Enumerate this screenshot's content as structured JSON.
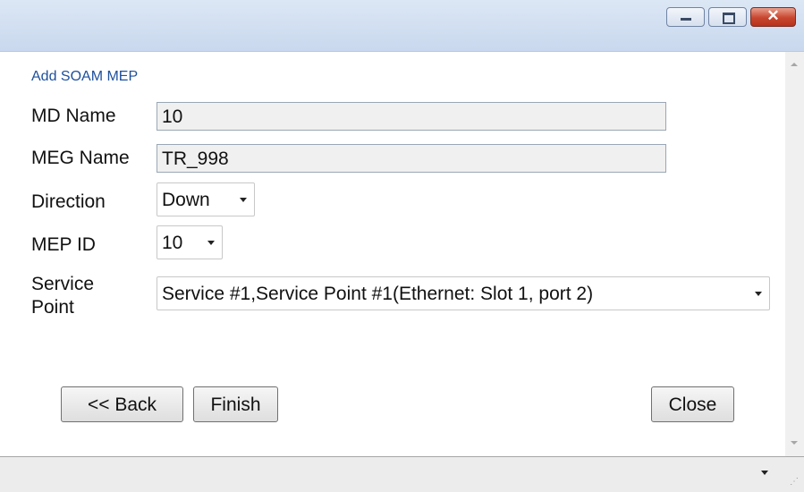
{
  "window": {
    "controls": {
      "minimize": "minimize-icon",
      "maximize": "maximize-icon",
      "close": "close-icon",
      "close_glyph": "✕"
    },
    "close_color": "#c7452e"
  },
  "form": {
    "title": "Add SOAM MEP",
    "md_name": {
      "label": "MD Name",
      "value": "10"
    },
    "meg_name": {
      "label": "MEG Name",
      "value": "TR_998"
    },
    "direction": {
      "label": "Direction",
      "value": "Down"
    },
    "mep_id": {
      "label": "MEP ID",
      "value": "10"
    },
    "service_point": {
      "label_line1": "Service",
      "label_line2": "Point",
      "value": "Service #1,Service Point #1(Ethernet: Slot 1, port 2)"
    }
  },
  "buttons": {
    "back": "<< Back",
    "finish": "Finish",
    "close": "Close"
  },
  "colors": {
    "heading": "#1e4f9c",
    "titlebar": "#c9d8ee"
  }
}
